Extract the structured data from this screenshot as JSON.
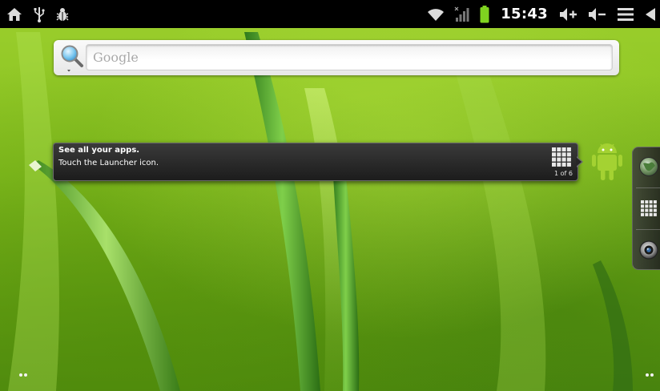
{
  "status_bar": {
    "left_icons": [
      "home-icon",
      "usb-icon",
      "debug-bug-icon"
    ],
    "right_icons": [
      "wifi-icon",
      "cell-signal-icon",
      "battery-icon",
      "volume-up-icon",
      "volume-down-icon",
      "menu-icon",
      "back-icon"
    ],
    "time": "15:43",
    "colors": {
      "background": "#000000",
      "battery": "#7fd320"
    }
  },
  "search": {
    "placeholder": "Google",
    "icon": "magnifier-icon"
  },
  "tooltip": {
    "title": "See all your apps.",
    "body": "Touch the Launcher icon.",
    "counter": "1 of 6",
    "icon": "launcher-grid-icon"
  },
  "launcher": {
    "icon": "android-robot-icon",
    "color": "#a4d232"
  },
  "dock": {
    "items": [
      {
        "name": "browser-globe-icon"
      },
      {
        "name": "app-drawer-grid-icon"
      },
      {
        "name": "camera-icon"
      }
    ]
  },
  "home_screen": {
    "page_indicators": [
      "left-page-dots",
      "right-page-dots"
    ]
  }
}
